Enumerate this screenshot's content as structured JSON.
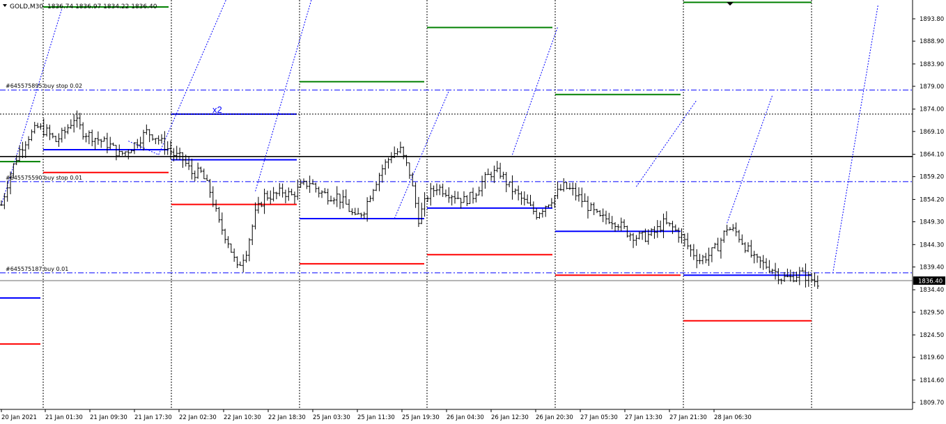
{
  "header": {
    "symbol_timeframe": "GOLD,M30",
    "ohlc": "1836.74 1836.97 1834.22 1836.40"
  },
  "orders": [
    {
      "label": "#645575895 buy stop 0.02",
      "price": 1878.2
    },
    {
      "label": "#645575590 buy stop 0.01",
      "price": 1858.1
    },
    {
      "label": "#645575187 buy 0.01",
      "price": 1838.1
    }
  ],
  "current_price": {
    "label": "1836.40",
    "value": 1836.4
  },
  "annotation": {
    "text": "x2"
  },
  "colors": {
    "green": "#008000",
    "blue": "#0000ff",
    "red": "#ff0000",
    "black": "#000000",
    "grid": "#000000",
    "axis_text": "#000000"
  },
  "chart_data": {
    "type": "candlestick",
    "title": "GOLD,M30",
    "y_axis": {
      "ticks": [
        1893.8,
        1888.9,
        1883.9,
        1879.0,
        1874.0,
        1869.1,
        1864.1,
        1859.2,
        1854.2,
        1849.3,
        1844.3,
        1839.4,
        1834.4,
        1829.5,
        1824.5,
        1819.6,
        1814.6,
        1809.7
      ],
      "tick_labels": [
        "1893.80",
        "1888.90",
        "1883.90",
        "1879.00",
        "1874.00",
        "1869.10",
        "1864.10",
        "1859.20",
        "1854.20",
        "1849.30",
        "1844.30",
        "1839.40",
        "1834.40",
        "1829.50",
        "1824.50",
        "1819.60",
        "1814.60",
        "1809.70"
      ],
      "range": [
        1807.5,
        1897.7
      ]
    },
    "x_axis": {
      "labels": [
        "20 Jan 2021",
        "21 Jan 01:30",
        "21 Jan 09:30",
        "21 Jan 17:30",
        "22 Jan 02:30",
        "22 Jan 10:30",
        "22 Jan 18:30",
        "25 Jan 03:30",
        "25 Jan 11:30",
        "25 Jan 19:30",
        "26 Jan 04:30",
        "26 Jan 12:30",
        "26 Jan 20:30",
        "27 Jan 05:30",
        "27 Jan 13:30",
        "27 Jan 21:30",
        "28 Jan 06:30"
      ]
    },
    "horizontal_lines": [
      {
        "price": 1863.6,
        "color": "black",
        "style": "solid"
      },
      {
        "price": 1872.9,
        "color": "black",
        "style": "dotted"
      },
      {
        "price": 1836.4,
        "color": "black",
        "style": "solid-thin"
      }
    ],
    "daily_levels": [
      {
        "day": 0,
        "green": 1862.5,
        "blue": 1832.6,
        "red": 1822.5
      },
      {
        "day": 1,
        "green": 1896.4,
        "blue": 1865.1,
        "red": 1860.1
      },
      {
        "day": 2,
        "green": null,
        "blue": 1872.9,
        "red": 1853.1
      },
      {
        "day": 2,
        "green": null,
        "blue": 1862.9,
        "red": null
      },
      {
        "day": 3,
        "green": 1880.0,
        "blue": 1850.0,
        "red": 1840.1
      },
      {
        "day": 4,
        "green": 1891.9,
        "blue": 1852.3,
        "red": 1842.1
      },
      {
        "day": 5,
        "green": 1877.2,
        "blue": 1847.2,
        "red": 1837.6
      },
      {
        "day": 6,
        "green": 1897.4,
        "blue": 1837.6,
        "red": 1827.6
      }
    ],
    "close_path": [
      [
        0,
        1853
      ],
      [
        3,
        1860
      ],
      [
        6,
        1865
      ],
      [
        9,
        1868
      ],
      [
        12,
        1870
      ],
      [
        15,
        1869
      ],
      [
        18,
        1867
      ],
      [
        21,
        1869
      ],
      [
        24,
        1872
      ],
      [
        27,
        1869
      ],
      [
        30,
        1868
      ],
      [
        33,
        1867
      ],
      [
        36,
        1866
      ],
      [
        39,
        1864
      ],
      [
        42,
        1865
      ],
      [
        45,
        1867
      ],
      [
        48,
        1869
      ],
      [
        51,
        1868
      ],
      [
        54,
        1866
      ],
      [
        57,
        1864
      ],
      [
        60,
        1863
      ],
      [
        63,
        1860
      ],
      [
        66,
        1860
      ],
      [
        69,
        1856
      ],
      [
        72,
        1849
      ],
      [
        75,
        1845
      ],
      [
        78,
        1839
      ],
      [
        81,
        1843
      ],
      [
        84,
        1851
      ],
      [
        87,
        1855
      ],
      [
        90,
        1855
      ],
      [
        93,
        1856
      ],
      [
        96,
        1855
      ],
      [
        99,
        1857
      ],
      [
        102,
        1858
      ],
      [
        105,
        1856
      ],
      [
        108,
        1855
      ],
      [
        111,
        1855
      ],
      [
        114,
        1853
      ],
      [
        117,
        1850
      ],
      [
        120,
        1852
      ],
      [
        123,
        1857
      ],
      [
        126,
        1861
      ],
      [
        129,
        1864
      ],
      [
        132,
        1865
      ],
      [
        135,
        1860
      ],
      [
        138,
        1850
      ],
      [
        141,
        1855
      ],
      [
        144,
        1857
      ],
      [
        147,
        1856
      ],
      [
        150,
        1855
      ],
      [
        153,
        1854
      ],
      [
        156,
        1855
      ],
      [
        159,
        1858
      ],
      [
        162,
        1860
      ],
      [
        165,
        1860
      ],
      [
        168,
        1857
      ],
      [
        171,
        1855
      ],
      [
        174,
        1853
      ],
      [
        177,
        1851
      ],
      [
        180,
        1853
      ],
      [
        183,
        1855
      ],
      [
        186,
        1857
      ],
      [
        189,
        1856
      ],
      [
        192,
        1854
      ],
      [
        195,
        1852
      ],
      [
        198,
        1850
      ],
      [
        201,
        1850
      ],
      [
        204,
        1849
      ],
      [
        207,
        1847
      ],
      [
        210,
        1846
      ],
      [
        213,
        1846
      ],
      [
        216,
        1847
      ],
      [
        219,
        1849
      ],
      [
        222,
        1848
      ],
      [
        225,
        1846
      ],
      [
        228,
        1843
      ],
      [
        231,
        1841
      ],
      [
        234,
        1842
      ],
      [
        237,
        1844
      ],
      [
        240,
        1848
      ],
      [
        243,
        1847
      ],
      [
        246,
        1844
      ],
      [
        249,
        1841
      ],
      [
        252,
        1840
      ],
      [
        255,
        1839
      ],
      [
        258,
        1837
      ],
      [
        261,
        1837
      ],
      [
        264,
        1838
      ],
      [
        267,
        1837
      ],
      [
        270,
        1836
      ]
    ],
    "trajectories": [
      {
        "from": [
          0,
          1853
        ],
        "to": [
          20,
          1896
        ]
      },
      {
        "from": [
          42,
          1867
        ],
        "to": [
          52,
          1864
        ]
      },
      {
        "from": [
          52,
          1864
        ],
        "to": [
          75,
          1899
        ]
      },
      {
        "from": [
          84,
          1856
        ],
        "to": [
          103,
          1899
        ]
      },
      {
        "from": [
          130,
          1850
        ],
        "to": [
          148,
          1878
        ]
      },
      {
        "from": [
          169,
          1864
        ],
        "to": [
          184,
          1892
        ]
      },
      {
        "from": [
          210,
          1857
        ],
        "to": [
          230,
          1876
        ]
      },
      {
        "from": [
          240,
          1849
        ],
        "to": [
          255,
          1877
        ]
      },
      {
        "from": [
          275,
          1838
        ],
        "to": [
          290,
          1897
        ]
      }
    ]
  }
}
